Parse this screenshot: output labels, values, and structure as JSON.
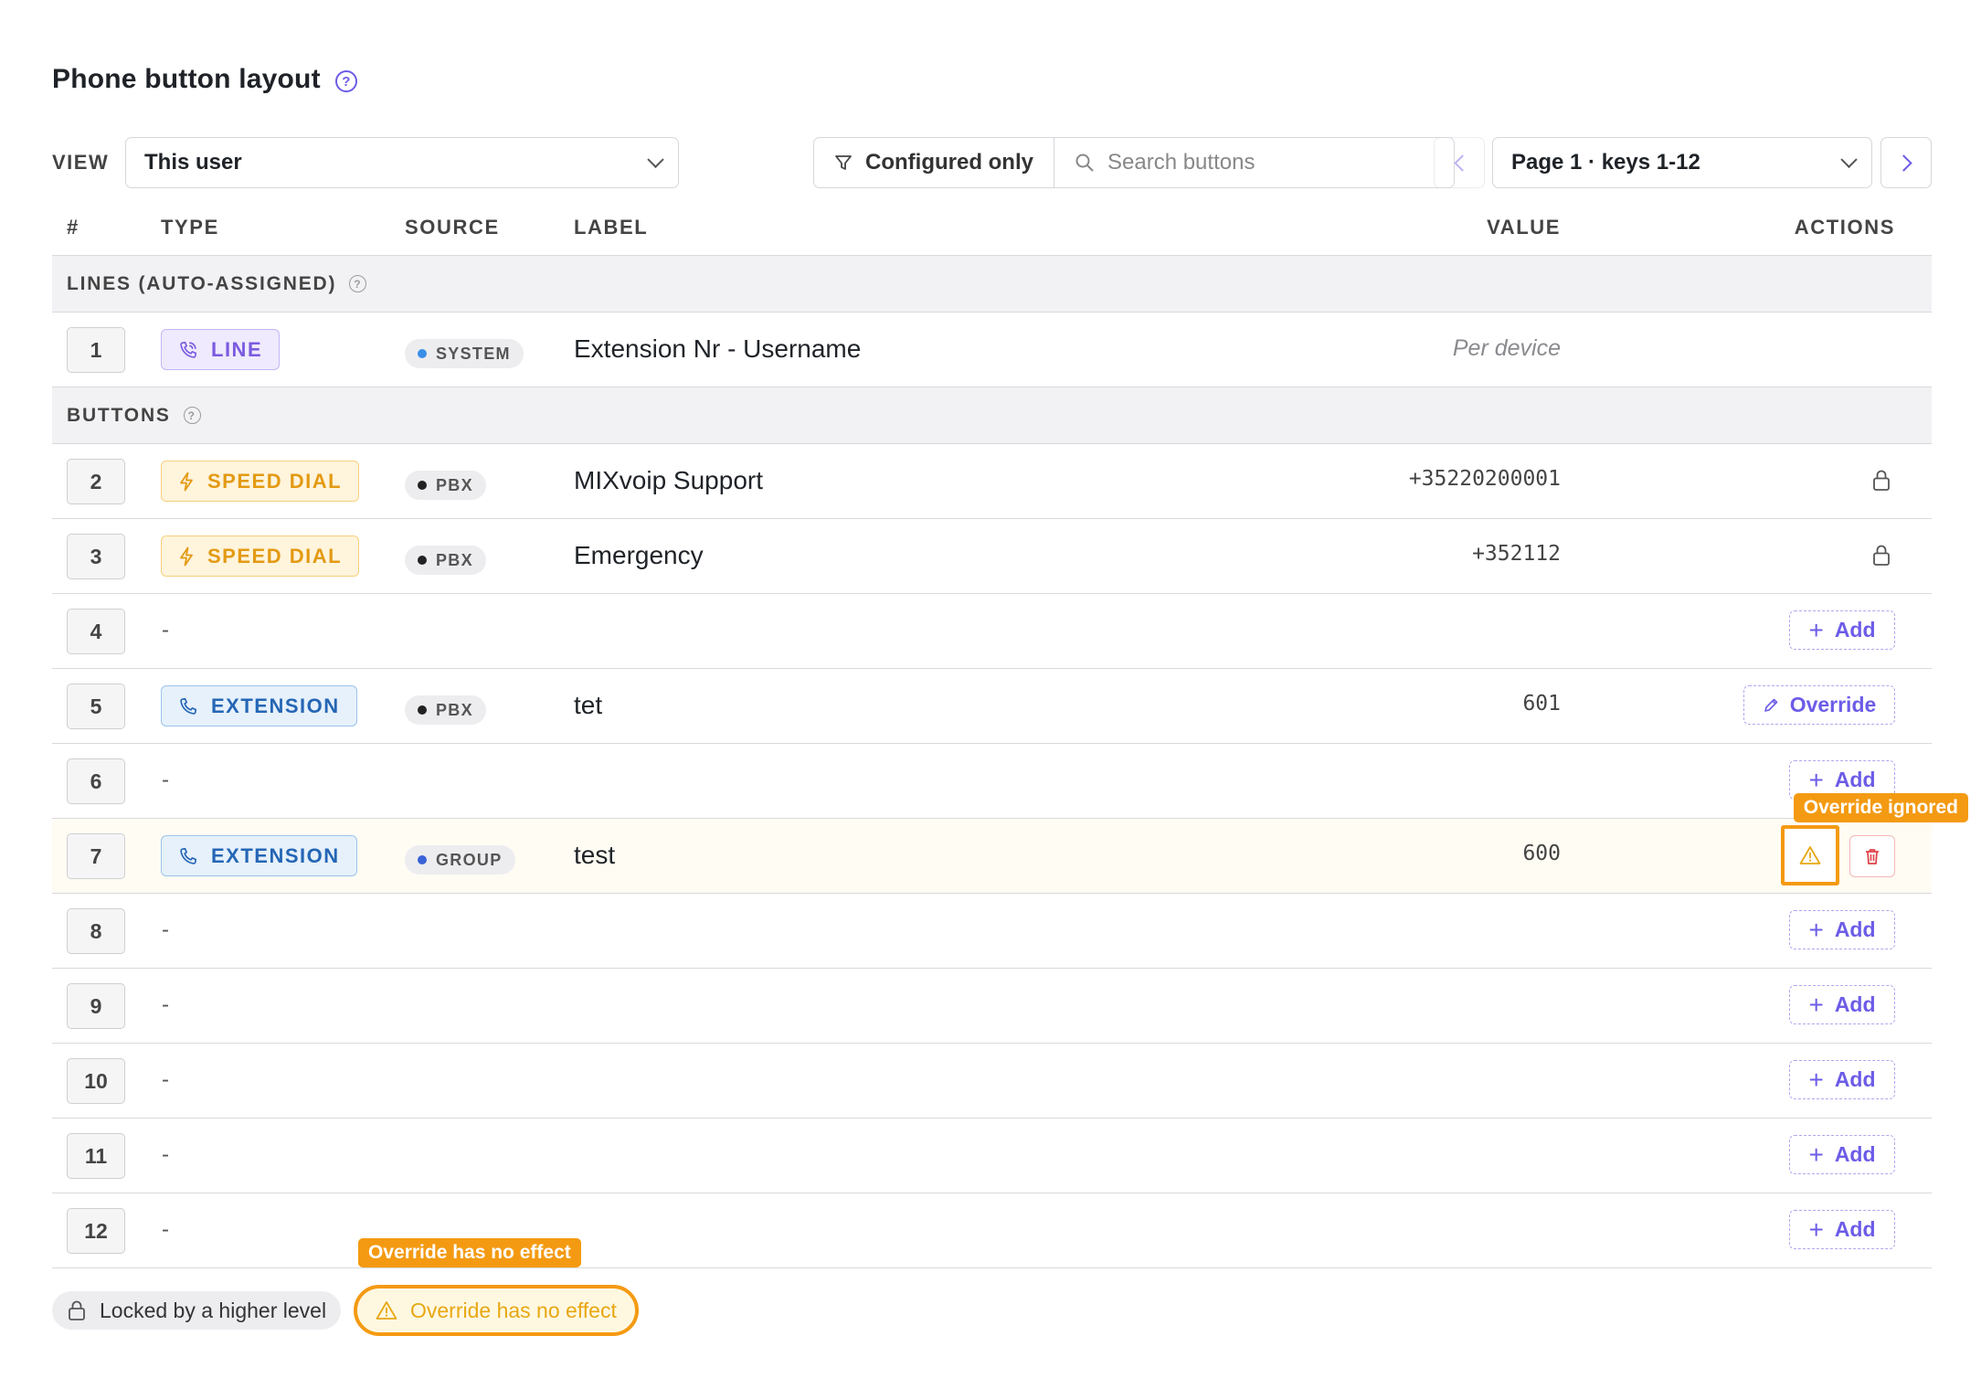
{
  "header": {
    "title": "Phone button layout"
  },
  "toolbar": {
    "view_label": "VIEW",
    "view_value": "This user",
    "filter_label": "Configured only",
    "search_placeholder": "Search buttons",
    "page_value": "Page 1 · keys 1-12"
  },
  "columns": {
    "num": "#",
    "type": "TYPE",
    "source": "SOURCE",
    "label": "LABEL",
    "value": "VALUE",
    "actions": "ACTIONS"
  },
  "sections": {
    "lines": "LINES (AUTO-ASSIGNED)",
    "buttons": "BUTTONS"
  },
  "colors": {
    "accent": "#6c5ce7",
    "warning": "#f49a12",
    "danger": "#e0434a"
  },
  "line_row": {
    "num": "1",
    "type": "LINE",
    "type_icon": "phone-line-icon",
    "source": "SYSTEM",
    "label": "Extension Nr - Username",
    "value": "Per device"
  },
  "rows": [
    {
      "num": "2",
      "type": "SPEED DIAL",
      "type_icon": "lightning-icon",
      "source": "PBX",
      "label": "MIXvoip Support",
      "value": "+35220200001",
      "action": "locked"
    },
    {
      "num": "3",
      "type": "SPEED DIAL",
      "type_icon": "lightning-icon",
      "source": "PBX",
      "label": "Emergency",
      "value": "+352112",
      "action": "locked"
    },
    {
      "num": "4",
      "empty": "-",
      "action": "Add"
    },
    {
      "num": "5",
      "type": "EXTENSION",
      "type_icon": "phone-icon",
      "source": "PBX",
      "label": "tet",
      "value": "601",
      "action": "Override"
    },
    {
      "num": "6",
      "empty": "-",
      "action": "Add"
    },
    {
      "num": "7",
      "type": "EXTENSION",
      "type_icon": "phone-icon",
      "source": "GROUP",
      "label": "test",
      "value": "600",
      "action": "warning-delete",
      "tooltip": "Override ignored"
    },
    {
      "num": "8",
      "empty": "-",
      "action": "Add"
    },
    {
      "num": "9",
      "empty": "-",
      "action": "Add"
    },
    {
      "num": "10",
      "empty": "-",
      "action": "Add"
    },
    {
      "num": "11",
      "empty": "-",
      "action": "Add"
    },
    {
      "num": "12",
      "empty": "-",
      "action": "Add"
    }
  ],
  "legend": {
    "locked": "Locked by a higher level",
    "no_effect": "Override has no effect",
    "no_effect_tooltip": "Override has no effect"
  }
}
